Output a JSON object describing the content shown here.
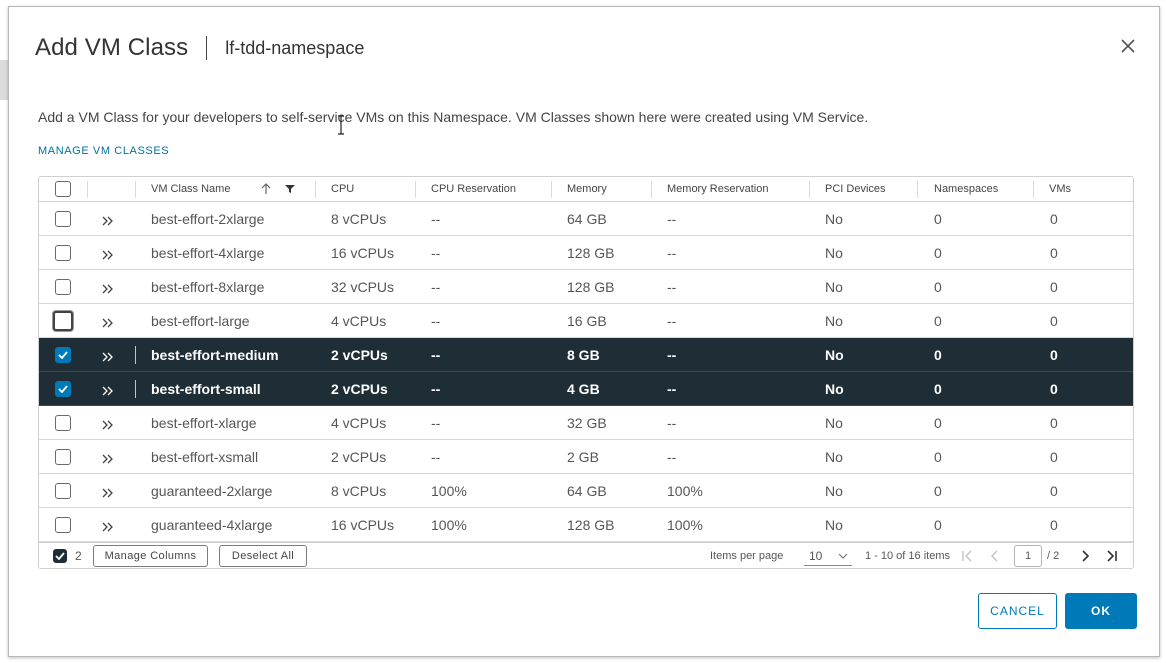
{
  "dialog": {
    "title": "Add VM Class",
    "subtitle": "lf-tdd-namespace",
    "description": "Add a VM Class for your developers to self-service VMs on this Namespace. VM Classes shown here were created using VM Service.",
    "manage_link": "MANAGE VM CLASSES",
    "close_icon": "close-icon"
  },
  "grid": {
    "columns": [
      "VM Class Name",
      "CPU",
      "CPU Reservation",
      "Memory",
      "Memory Reservation",
      "PCI Devices",
      "Namespaces",
      "VMs"
    ],
    "sort_icon": "sort-ascending-icon",
    "filter_icon": "filter-icon",
    "rows": [
      {
        "name": "best-effort-2xlarge",
        "cpu": "8 vCPUs",
        "cpu_res": "--",
        "memory": "64 GB",
        "mem_res": "--",
        "pci": "No",
        "namespaces": "0",
        "vms": "0",
        "selected": false
      },
      {
        "name": "best-effort-4xlarge",
        "cpu": "16 vCPUs",
        "cpu_res": "--",
        "memory": "128 GB",
        "mem_res": "--",
        "pci": "No",
        "namespaces": "0",
        "vms": "0",
        "selected": false
      },
      {
        "name": "best-effort-8xlarge",
        "cpu": "32 vCPUs",
        "cpu_res": "--",
        "memory": "128 GB",
        "mem_res": "--",
        "pci": "No",
        "namespaces": "0",
        "vms": "0",
        "selected": false
      },
      {
        "name": "best-effort-large",
        "cpu": "4 vCPUs",
        "cpu_res": "--",
        "memory": "16 GB",
        "mem_res": "--",
        "pci": "No",
        "namespaces": "0",
        "vms": "0",
        "selected": false
      },
      {
        "name": "best-effort-medium",
        "cpu": "2 vCPUs",
        "cpu_res": "--",
        "memory": "8 GB",
        "mem_res": "--",
        "pci": "No",
        "namespaces": "0",
        "vms": "0",
        "selected": true
      },
      {
        "name": "best-effort-small",
        "cpu": "2 vCPUs",
        "cpu_res": "--",
        "memory": "4 GB",
        "mem_res": "--",
        "pci": "No",
        "namespaces": "0",
        "vms": "0",
        "selected": true
      },
      {
        "name": "best-effort-xlarge",
        "cpu": "4 vCPUs",
        "cpu_res": "--",
        "memory": "32 GB",
        "mem_res": "--",
        "pci": "No",
        "namespaces": "0",
        "vms": "0",
        "selected": false
      },
      {
        "name": "best-effort-xsmall",
        "cpu": "2 vCPUs",
        "cpu_res": "--",
        "memory": "2 GB",
        "mem_res": "--",
        "pci": "No",
        "namespaces": "0",
        "vms": "0",
        "selected": false
      },
      {
        "name": "guaranteed-2xlarge",
        "cpu": "8 vCPUs",
        "cpu_res": "100%",
        "memory": "64 GB",
        "mem_res": "100%",
        "pci": "No",
        "namespaces": "0",
        "vms": "0",
        "selected": false
      },
      {
        "name": "guaranteed-4xlarge",
        "cpu": "16 vCPUs",
        "cpu_res": "100%",
        "memory": "128 GB",
        "mem_res": "100%",
        "pci": "No",
        "namespaces": "0",
        "vms": "0",
        "selected": false
      }
    ]
  },
  "footer": {
    "selected_count": "2",
    "manage_columns": "Manage Columns",
    "deselect_all": "Deselect All",
    "items_per_page_label": "Items per page",
    "items_per_page_value": "10",
    "range_text": "1 - 10 of 16 items",
    "current_page": "1",
    "total_pages": "/ 2"
  },
  "actions": {
    "cancel": "CANCEL",
    "ok": "OK"
  },
  "colors": {
    "accent": "#0079b8",
    "selected_row": "#1f2e36"
  }
}
